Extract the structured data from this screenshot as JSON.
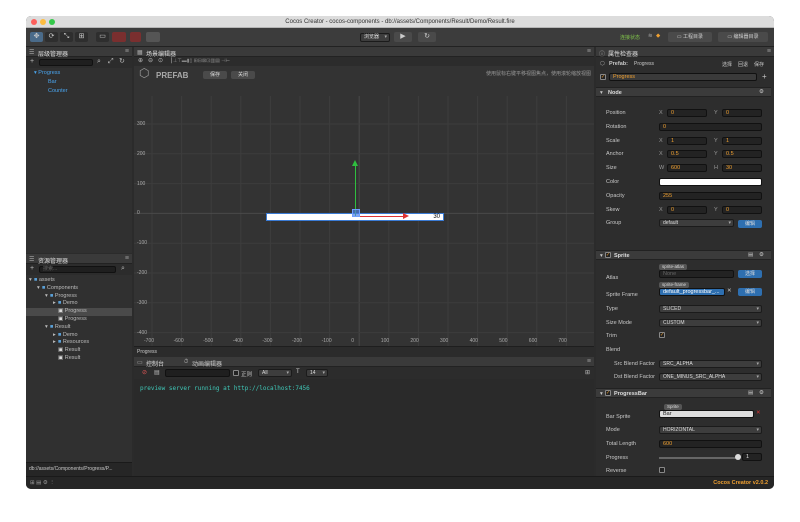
{
  "window": {
    "title": "Cocos Creator - cocos-components - db://assets/Components/Result/Demo/Result.fire"
  },
  "toolbar": {
    "tools": [
      "✥",
      "⟳",
      "⤡",
      "⊞",
      "▭"
    ],
    "preview_target": "浏览器",
    "play": "▶",
    "refresh": "↻",
    "project_btn": "工程目录",
    "editor_btn": "编辑器目录",
    "status_text": "连接状态"
  },
  "hierarchy": {
    "title": "层级管理器",
    "items": [
      "Progress",
      "Bar",
      "Counter"
    ]
  },
  "assets": {
    "title": "资源管理器",
    "search_placeholder": "搜索...",
    "items": [
      {
        "label": "assets",
        "icon": "▾",
        "indent": 0
      },
      {
        "label": "Components",
        "icon": "▾",
        "indent": 1
      },
      {
        "label": "Progress",
        "icon": "▾",
        "indent": 2
      },
      {
        "label": "Demo",
        "icon": "▸",
        "indent": 3
      },
      {
        "label": "Progress",
        "icon": "",
        "indent": 3,
        "selected": true
      },
      {
        "label": "Progress",
        "icon": "",
        "indent": 3
      },
      {
        "label": "Result",
        "icon": "▾",
        "indent": 2
      },
      {
        "label": "Demo",
        "icon": "▸",
        "indent": 3
      },
      {
        "label": "Resources",
        "icon": "▸",
        "indent": 3
      },
      {
        "label": "Result",
        "icon": "",
        "indent": 3
      },
      {
        "label": "Result",
        "icon": "",
        "indent": 3
      }
    ],
    "status_path": "db://assets/Components/Progress/P..."
  },
  "scene": {
    "title": "场景编辑器",
    "prefab_label": "PREFAB",
    "save_btn": "保存",
    "close_btn": "关闭",
    "hint": "使用鼠标右键平移视图焦点，使用滚轮缩放视图",
    "x_ticks": [
      "-700",
      "-600",
      "-500",
      "-400",
      "-300",
      "-200",
      "-100",
      "0",
      "100",
      "200",
      "300",
      "400",
      "500",
      "600",
      "700"
    ],
    "y_ticks": [
      "300",
      "200",
      "100",
      "0",
      "-100",
      "-200",
      "-300",
      "-400"
    ],
    "bar_value": "30",
    "node_name": "Progress"
  },
  "console": {
    "tab1": "控制台",
    "tab2": "动画编辑器",
    "regex_label": "正则",
    "level": "All",
    "font_size": "14",
    "message": "preview server running at http://localhost:7456"
  },
  "inspector": {
    "title": "属性检查器",
    "prefab_label": "Prefab:",
    "prefab_name": "Progress",
    "prefab_actions": [
      "选择",
      "回退",
      "保存"
    ],
    "node_name": "Progress",
    "node_section": "Node",
    "position": {
      "label": "Position",
      "x": "0",
      "y": "0"
    },
    "rotation": {
      "label": "Rotation",
      "v": "0"
    },
    "scale": {
      "label": "Scale",
      "x": "1",
      "y": "1"
    },
    "anchor": {
      "label": "Anchor",
      "x": "0.5",
      "y": "0.5"
    },
    "size": {
      "label": "Size",
      "w": "600",
      "h": "30"
    },
    "color": {
      "label": "Color",
      "value": "#ffffff"
    },
    "opacity": {
      "label": "Opacity",
      "v": "255"
    },
    "skew": {
      "label": "Skew",
      "x": "0",
      "y": "0"
    },
    "group": {
      "label": "Group",
      "v": "default",
      "btn": "编辑"
    },
    "sprite_section": "Sprite",
    "atlas": {
      "label": "Atlas",
      "tag": "sprite-atlas",
      "v": "None",
      "btn": "选择"
    },
    "sprite_frame": {
      "label": "Sprite Frame",
      "tag": "sprite-frame",
      "v": "default_progressbar_...",
      "btn": "编辑"
    },
    "type": {
      "label": "Type",
      "v": "SLICED"
    },
    "size_mode": {
      "label": "Size Mode",
      "v": "CUSTOM"
    },
    "trim": {
      "label": "Trim"
    },
    "blend": {
      "label": "Blend"
    },
    "src_blend": {
      "label": "Src Blend Factor",
      "v": "SRC_ALPHA"
    },
    "dst_blend": {
      "label": "Dst Blend Factor",
      "v": "ONE_MINUS_SRC_ALPHA"
    },
    "pb_section": "ProgressBar",
    "bar_sprite": {
      "label": "Bar Sprite",
      "tag": "Sprite",
      "v": "Bar"
    },
    "mode": {
      "label": "Mode",
      "v": "HORIZONTAL"
    },
    "total_length": {
      "label": "Total Length",
      "v": "600"
    },
    "progress": {
      "label": "Progress",
      "v": "1"
    },
    "reverse": {
      "label": "Reverse"
    },
    "version": "Cocos Creator v2.0.2"
  }
}
